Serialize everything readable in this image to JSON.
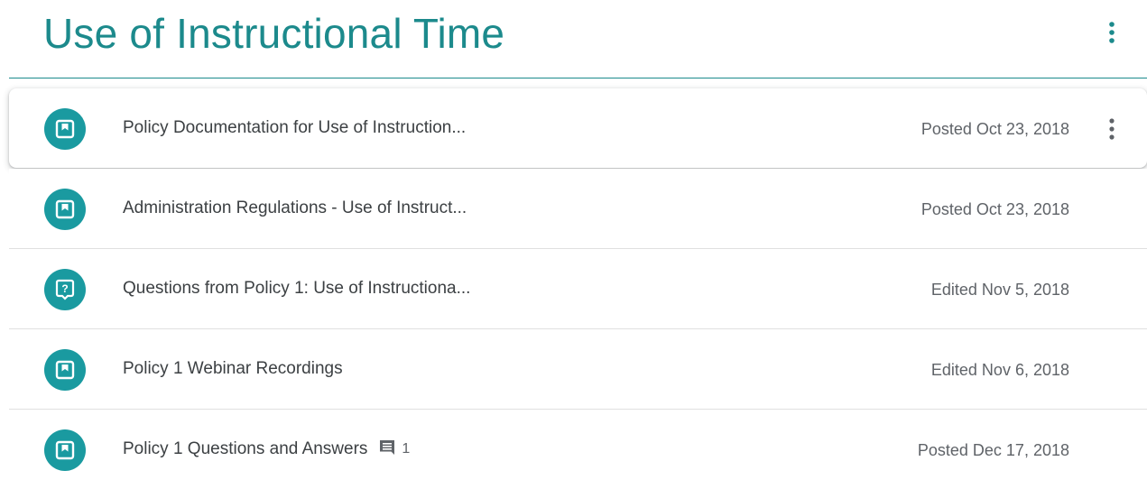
{
  "page": {
    "title": "Use of Instructional Time",
    "accent_color": "#1c8a8c",
    "header_menu_icon": "more-vert-icon"
  },
  "items": [
    {
      "title": "Policy Documentation for Use of Instruction...",
      "date": "Posted Oct 23, 2018",
      "icon": "material-icon",
      "active": true
    },
    {
      "title": "Administration Regulations - Use of Instruct...",
      "date": "Posted Oct 23, 2018",
      "icon": "material-icon"
    },
    {
      "title": "Questions from Policy 1: Use of Instructiona...",
      "date": "Edited Nov 5, 2018",
      "icon": "question-icon"
    },
    {
      "title": "Policy 1 Webinar Recordings",
      "date": "Edited Nov 6, 2018",
      "icon": "material-icon"
    },
    {
      "title": "Policy 1 Questions and Answers",
      "date": "Posted Dec 17, 2018",
      "icon": "material-icon",
      "comment_count": "1",
      "comment_icon": "comment-icon"
    }
  ]
}
